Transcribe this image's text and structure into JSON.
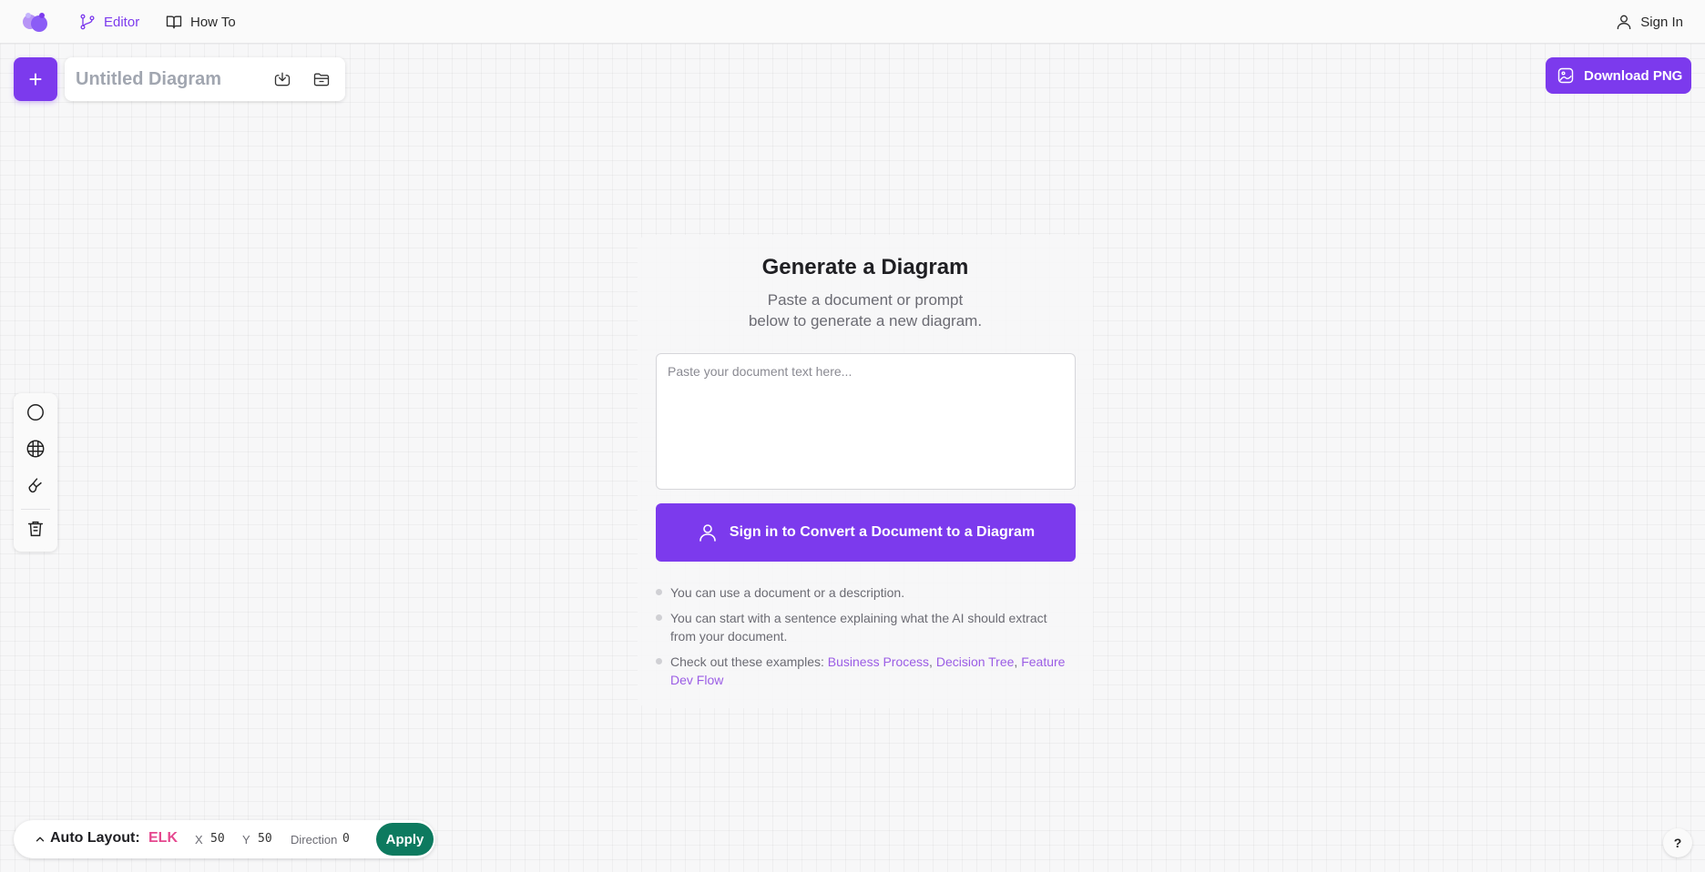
{
  "nav": {
    "editor_label": "Editor",
    "howto_label": "How To",
    "signin_label": "Sign In"
  },
  "toolbar": {
    "new_label": "+",
    "title_placeholder": "Untitled Diagram",
    "download_png_label": "Download PNG"
  },
  "generate": {
    "title": "Generate a Diagram",
    "subtitle_line1": "Paste a document or prompt",
    "subtitle_line2": "below to generate a new diagram.",
    "textarea_placeholder": "Paste your document text here...",
    "convert_label": "Sign in to Convert a Document to a Diagram",
    "tips": {
      "tip1": "You can use a document or a description.",
      "tip2": "You can start with a sentence explaining what the AI should extract from your document.",
      "tip3_prefix": "Check out these examples: ",
      "examples": [
        "Business Process",
        "Decision Tree",
        "Feature Dev Flow"
      ]
    }
  },
  "auto_layout": {
    "label": "Auto Layout:",
    "engine": "ELK",
    "x_label": "X",
    "x_value": "50",
    "y_label": "Y",
    "y_value": "50",
    "direction_label": "Direction",
    "direction_value": "0",
    "apply_label": "Apply"
  },
  "help_label": "?",
  "colors": {
    "accent": "#7c3aed",
    "link": "#9b5de5",
    "apply": "#0d7a5f",
    "engine": "#e5488f"
  },
  "icons": [
    "logo-icon",
    "git-branch-icon",
    "book-open-icon",
    "user-icon",
    "download-icon",
    "folder-icon",
    "image-icon",
    "circle-icon",
    "grid-icon",
    "brush-icon",
    "trash-icon",
    "chevron-up-icon"
  ]
}
